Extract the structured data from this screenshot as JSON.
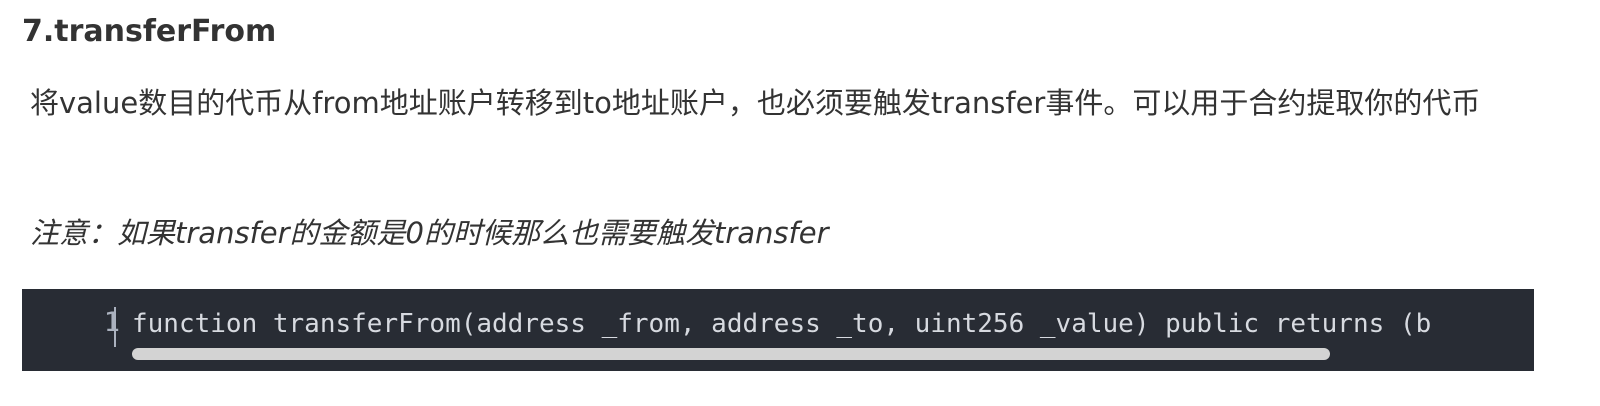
{
  "section": {
    "heading": "7.transferFrom",
    "description": "将value数目的代币从from地址账户转移到to地址账户，也必须要触发transfer事件。可以用于合约提取你的代币",
    "note": "注意：如果transfer的金额是0的时候那么也需要触发transfer"
  },
  "code": {
    "line_number": "1",
    "line": "function transferFrom(address _from, address _to, uint256 _value) public returns (b"
  }
}
